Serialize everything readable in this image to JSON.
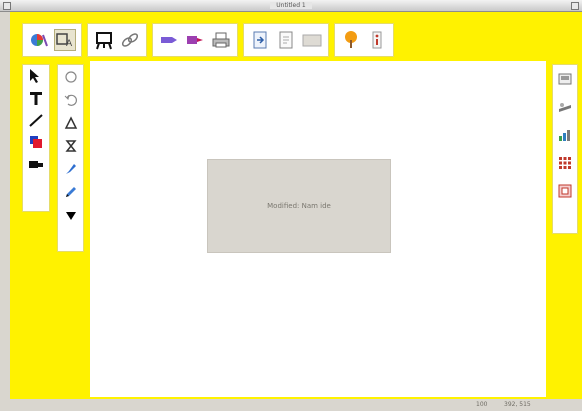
{
  "window": {
    "title": "Untitled 1"
  },
  "toolbar": {
    "groups": [
      {
        "items": [
          {
            "icon": "color-palette-icon"
          },
          {
            "icon": "editor-mode-icon",
            "selected": true
          }
        ]
      },
      {
        "items": [
          {
            "icon": "easel-icon"
          },
          {
            "icon": "link-chain-icon"
          }
        ]
      },
      {
        "items": [
          {
            "icon": "tag-forward-icon"
          },
          {
            "icon": "tag-backward-icon"
          },
          {
            "icon": "printer-icon"
          }
        ]
      },
      {
        "items": [
          {
            "icon": "import-icon"
          },
          {
            "icon": "page-icon"
          },
          {
            "icon": "blank-card-icon"
          }
        ]
      },
      {
        "items": [
          {
            "icon": "help-tree-icon"
          },
          {
            "icon": "info-icon"
          }
        ]
      }
    ]
  },
  "left_tools": [
    {
      "icon": "arrow-pointer-icon"
    },
    {
      "icon": "text-tool-icon"
    },
    {
      "icon": "line-tool-icon"
    },
    {
      "icon": "fill-color-icon"
    },
    {
      "icon": "stamp-tool-icon"
    }
  ],
  "shape_tools": [
    {
      "icon": "circle-shape-icon"
    },
    {
      "icon": "arc-shape-icon"
    },
    {
      "icon": "triangle-shape-icon"
    },
    {
      "icon": "hourglass-shape-icon"
    },
    {
      "icon": "pen-shape-icon"
    },
    {
      "icon": "pencil-shape-icon"
    },
    {
      "icon": "dropdown-triangle-icon"
    }
  ],
  "right_tools": [
    {
      "icon": "card-view-icon"
    },
    {
      "icon": "shape-tray-icon"
    },
    {
      "icon": "chart-tool-icon"
    },
    {
      "icon": "grid-icon"
    },
    {
      "icon": "frame-icon"
    }
  ],
  "canvas": {
    "button_label": "Modified: Nam ide"
  },
  "status": {
    "zoom": "100",
    "coords": "392, 515"
  },
  "colors": {
    "window_background": "#fff200",
    "canvas": "#ffffff",
    "canvas_button": "#d9d6cf"
  }
}
